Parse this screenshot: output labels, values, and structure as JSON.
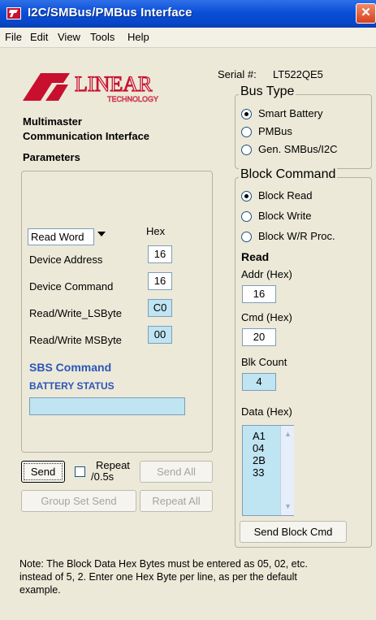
{
  "window": {
    "title": "I2C/SMBus/PMBus Interface",
    "close_glyph": "✕"
  },
  "menu": [
    "File",
    "Edit",
    "View",
    "Tools",
    "Help"
  ],
  "logo": {
    "brand": "LINEAR",
    "sub": "TECHNOLOGY"
  },
  "header": {
    "line1": "Multimaster",
    "line2": "Communication Interface",
    "parameters": "Parameters",
    "serial_label": "Serial #:",
    "serial_value": "LT522QE5"
  },
  "bus_type": {
    "title": "Bus Type",
    "options": [
      "Smart Battery",
      "PMBus",
      "Gen. SMBus/I2C"
    ],
    "selected": "Smart Battery"
  },
  "block_command": {
    "title": "Block Command",
    "options": [
      "Block Read",
      "Block Write",
      "Block W/R Proc."
    ],
    "selected": "Block Read",
    "read_label": "Read",
    "addr_label": "Addr (Hex)",
    "addr_value": "16",
    "cmd_label": "Cmd (Hex)",
    "cmd_value": "20",
    "blk_count_label": "Blk Count",
    "blk_count_value": "4",
    "data_label": "Data (Hex)",
    "data_values": [
      "A1",
      "04",
      "2B",
      "33"
    ],
    "send_label": "Send Block Cmd"
  },
  "params": {
    "mode_select": "Read Word",
    "hex_label": "Hex",
    "device_address_label": "Device Address",
    "device_address_value": "16",
    "device_command_label": "Device Command",
    "device_command_value": "16",
    "rw_lsbyte_label": "Read/Write_LSByte",
    "rw_lsbyte_value": "C0",
    "rw_msbyte_label": "Read/Write MSByte",
    "rw_msbyte_value": "00",
    "sbs_command_label": "SBS Command",
    "sbs_command_name": "BATTERY STATUS",
    "sbs_value": ""
  },
  "buttons": {
    "send": "Send",
    "repeat_line1": "Repeat",
    "repeat_line2": "/0.5s",
    "send_all": "Send All",
    "group_set_send": "Group Set Send",
    "repeat_all": "Repeat All"
  },
  "note": [
    "Note:  The Block Data Hex Bytes must be entered as 05, 02, etc.",
    "instead of 5, 2. Enter one Hex Byte per line, as per the default",
    "example."
  ]
}
